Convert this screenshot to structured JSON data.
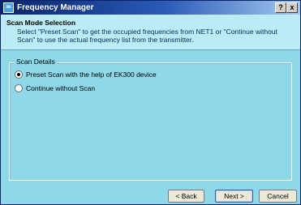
{
  "window": {
    "title": "Frequency Manager",
    "app_icon": "frequency-app-icon",
    "help_label": "?",
    "close_label": "x"
  },
  "header": {
    "title": "Scan Mode Selection",
    "description": "Select \"Preset Scan\" to get the occupied frequencies from NET1 or \"Continue without Scan\" to use the actual frequency list from the transmitter."
  },
  "scan_details": {
    "legend": "Scan Details",
    "options": [
      {
        "label": "Preset Scan with the help of EK300 device",
        "checked": true
      },
      {
        "label": "Continue without Scan",
        "checked": false
      }
    ]
  },
  "buttons": {
    "back": "< Back",
    "next": "Next >",
    "cancel": "Cancel"
  },
  "colors": {
    "background": "#8ed8e9",
    "header_background": "#bdebf5",
    "titlebar": "#0a246a"
  }
}
